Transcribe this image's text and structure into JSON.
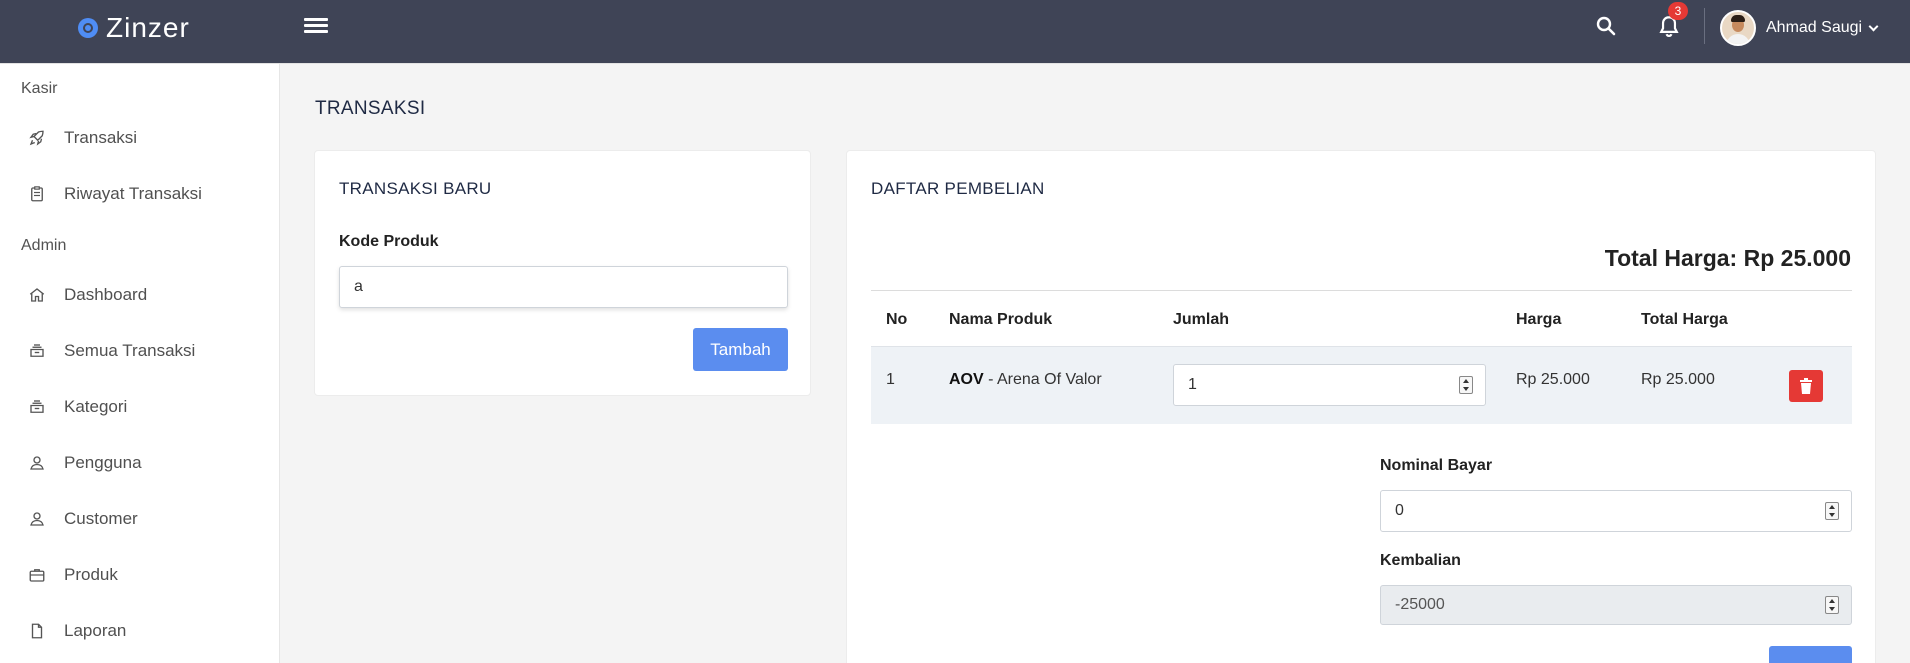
{
  "brand": {
    "name": "Zinzer"
  },
  "topbar": {
    "notification_count": "3",
    "user_name": "Ahmad Saugi"
  },
  "sidebar": {
    "sections": [
      {
        "title": "Kasir"
      },
      {
        "title": "Admin"
      }
    ],
    "items": [
      {
        "label": "Transaksi",
        "icon": "rocket-icon"
      },
      {
        "label": "Riwayat Transaksi",
        "icon": "clipboard-icon"
      },
      {
        "label": "Dashboard",
        "icon": "home-icon"
      },
      {
        "label": "Semua Transaksi",
        "icon": "layers-icon"
      },
      {
        "label": "Kategori",
        "icon": "layers-icon"
      },
      {
        "label": "Pengguna",
        "icon": "user-icon"
      },
      {
        "label": "Customer",
        "icon": "user-icon"
      },
      {
        "label": "Produk",
        "icon": "briefcase-icon"
      },
      {
        "label": "Laporan",
        "icon": "file-icon"
      }
    ]
  },
  "page": {
    "title": "TRANSAKSI"
  },
  "new_transaction": {
    "title": "TRANSAKSI BARU",
    "code_label": "Kode Produk",
    "code_value": "a",
    "add_button": "Tambah"
  },
  "purchase_list": {
    "title": "DAFTAR PEMBELIAN",
    "total_label": "Total Harga: Rp 25.000",
    "columns": [
      "No",
      "Nama Produk",
      "Jumlah",
      "Harga",
      "Total Harga"
    ],
    "rows": [
      {
        "no": "1",
        "code": "AOV",
        "name": " - Arena Of Valor",
        "qty": "1",
        "price": "Rp 25.000",
        "total": "Rp 25.000"
      }
    ],
    "pay_label": "Nominal Bayar",
    "pay_value": "0",
    "change_label": "Kembalian",
    "change_value": "-25000"
  },
  "colors": {
    "topbar": "#3f4456",
    "primary": "#5b8def",
    "danger": "#e53935"
  }
}
